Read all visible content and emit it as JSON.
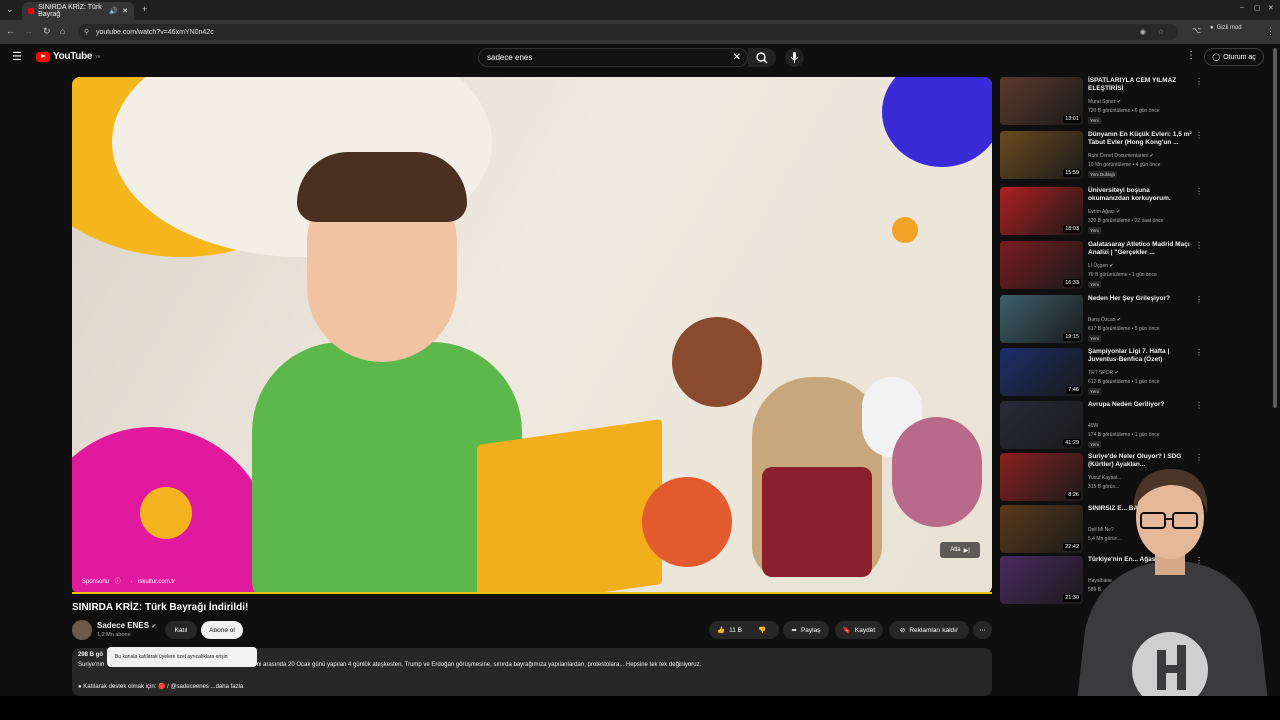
{
  "browser": {
    "tab_title": "SINIRDA KRİZ: Türk Bayrağ",
    "url": "youtube.com/watch?v=46xmYN0n42c",
    "incognito_label": "Gizli mod"
  },
  "header": {
    "logo": "YouTube",
    "logo_region": "TR",
    "search_value": "sadece enes",
    "signin_label": "Oturum aç"
  },
  "video": {
    "sponsor_label": "Sponsorlu",
    "sponsor_domain": "iskultur.com.tr",
    "skip_label": "Atla",
    "title": "SINIRDA KRİZ: Türk Bayrağı İndirildi!",
    "channel": "Sadece ENES",
    "subscribers": "1,2 Mn abone",
    "join_label": "Katıl",
    "subscribe_label": "Abone ol",
    "likes": "11 B",
    "share_label": "Paylaş",
    "save_label": "Kaydet",
    "remove_ads_label": "Reklamları kaldır",
    "tooltip": "Bu kanala katılarak üyelere özel ayrıcalıklara erişin",
    "desc_views": "298 B gö",
    "desc_line1_start": "Suriye'nin",
    "desc_line1_rest": "mi arasında 20 Ocak günü yapılan 4 günlük ateşkesten, Trump ve Erdoğan görüşmesine, sınırda bayrağımıza yapılanlardan, protestolara... Hepsine tek tek değiniyoruz.",
    "desc_line2": "● Katılarak destek olmak için: 🔴 / @sadeceenes ...daha fazla"
  },
  "recommendations": [
    {
      "title": "İSPATLARIYLA CEM YILMAZ ELEŞTİRİSİ",
      "channel": "Murat Soner ✔",
      "meta": "720 B görüntüleme • 6 gün önce",
      "badge": "Yeni",
      "duration": "13:01"
    },
    {
      "title": "Dünyanın En Küçük Evleri: 1,5 m² Tabut Evler (Hong Kong'un ...",
      "channel": "Ruhi Cenet Documentaries ✔",
      "meta": "10 Mn görüntüleme • 4 gün önce",
      "badge": "Yeni  Dublajlı",
      "duration": "15:59"
    },
    {
      "title": "Üniversiteyi boşuna okumanızdan korkuyorum.",
      "channel": "Evrim Ağacı ✔",
      "meta": "320 B görüntüleme • 22 saat önce",
      "badge": "Yeni",
      "duration": "18:03"
    },
    {
      "title": "Galatasaray Atletico Madrid Maçı Analizi | \"Gerçekler ...",
      "channel": "Lİ Üçgen ✔",
      "meta": "79 B görüntüleme • 1 gün önce",
      "badge": "Yeni",
      "duration": "16:33"
    },
    {
      "title": "Neden Her Şey Grileşiyor?",
      "channel": "Barış Özcan ✔",
      "meta": "617 B görüntüleme • 5 gün önce",
      "badge": "Yeni",
      "duration": "19:15"
    },
    {
      "title": "Şampiyonlar Ligi 7. Hafta | Juventus-Benfica (Özet)",
      "channel": "TRT SPOR ✔",
      "meta": "612 B görüntüleme • 1 gün önce",
      "badge": "Yeni",
      "duration": "7:46"
    },
    {
      "title": "Avrupa Neden Geriliyor?",
      "channel": "49W",
      "meta": "174 B görüntüleme • 1 gün önce",
      "badge": "Yeni",
      "duration": "41:29"
    },
    {
      "title": "Suriye'de Neler Oluyor? l SDG (Kürtler) Ayaklan...",
      "channel": "Yusuf Kayaal...",
      "meta": "315 B görün...",
      "badge": "",
      "duration": "8:26"
    },
    {
      "title": "SINIRSIZ E... BATIRDIK!",
      "channel": "Deli Mi Ne?",
      "meta": "5,4 Mn görün...",
      "badge": "",
      "duration": "22:42"
    },
    {
      "title": "Türkiye'nin En... Ağasıym",
      "channel": "Hayalhane...",
      "meta": "589 B...",
      "badge": "",
      "duration": "21:30"
    }
  ]
}
